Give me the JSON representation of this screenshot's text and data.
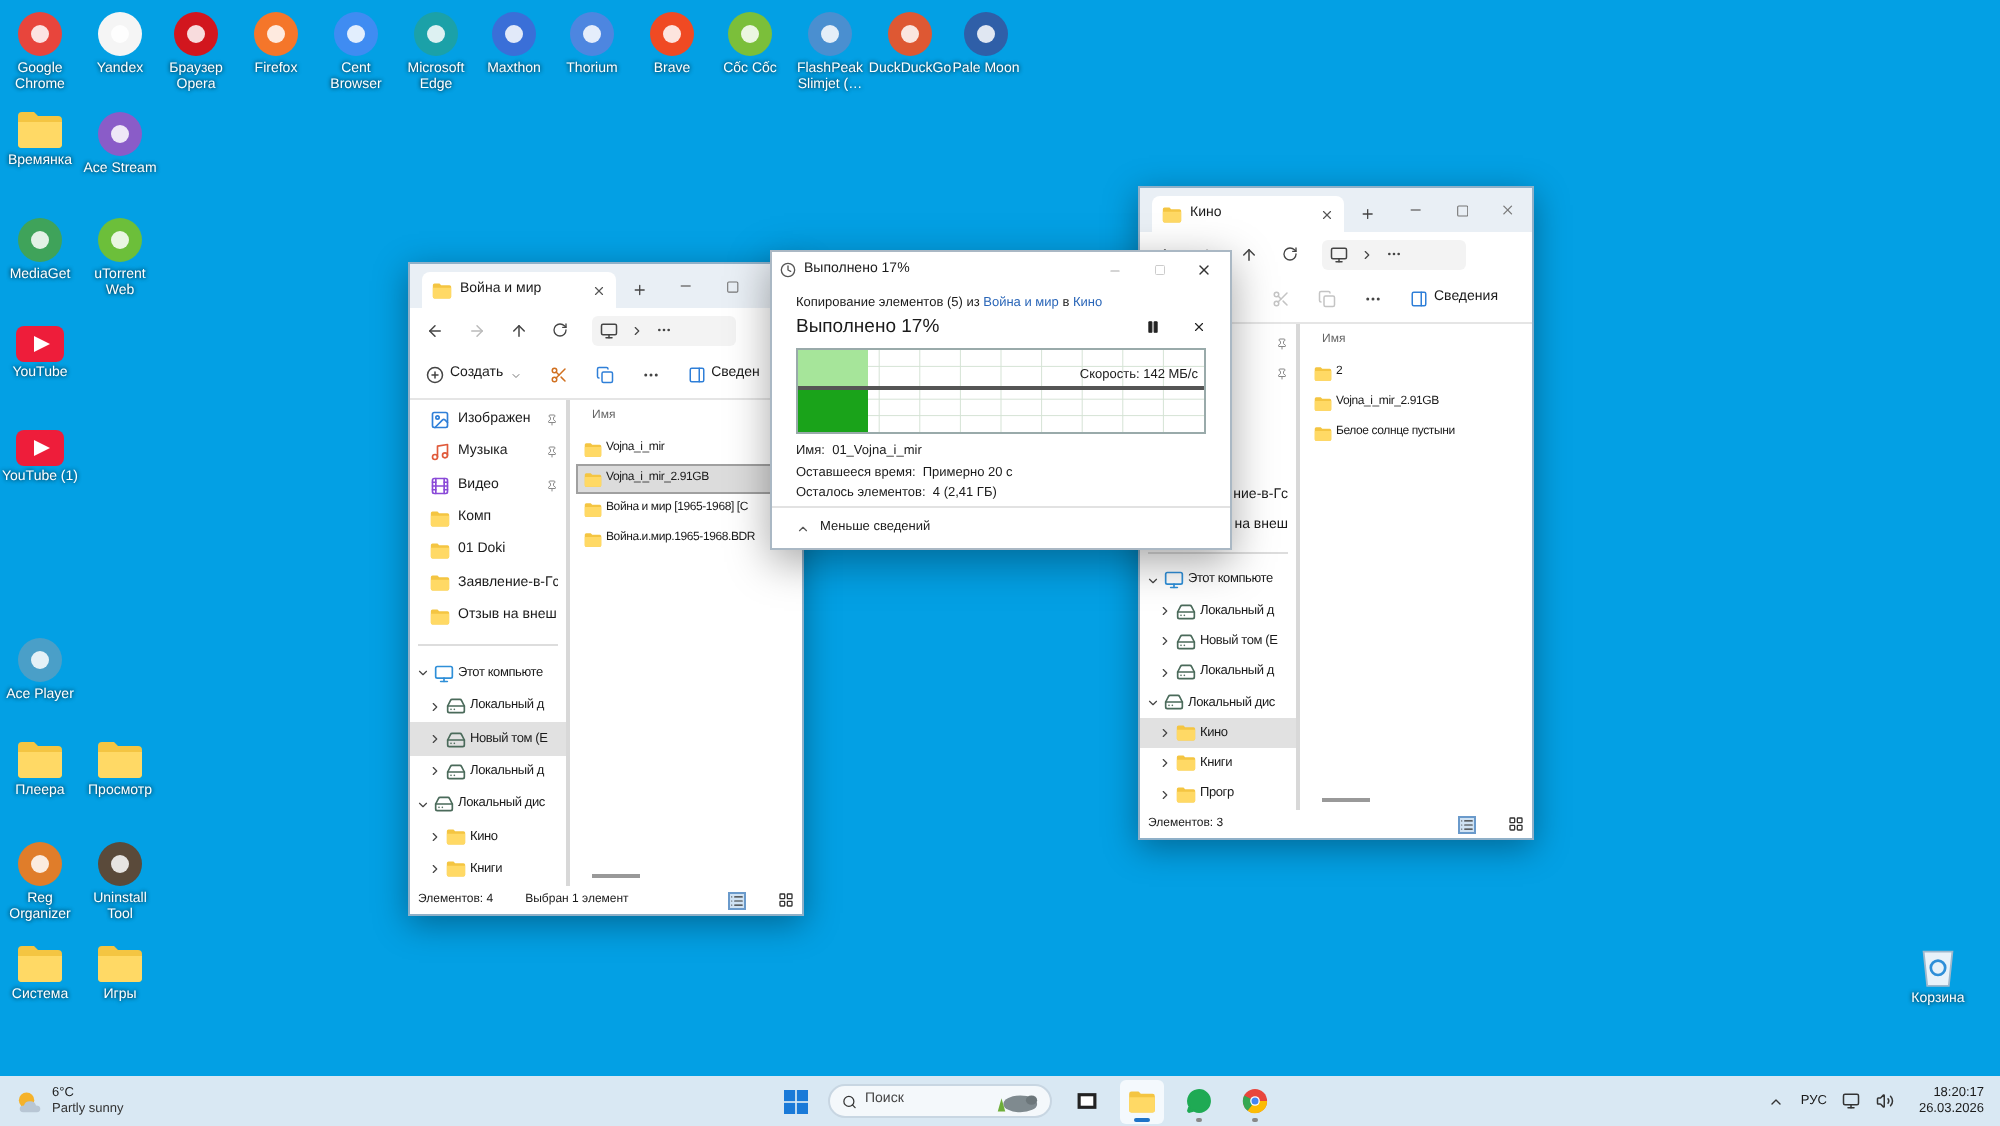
{
  "desktop": {
    "top_row": [
      {
        "label": "Google Chrome",
        "kind": "app",
        "color": "#e8453c"
      },
      {
        "label": "Yandex",
        "kind": "app",
        "color": "#f5f5f5"
      },
      {
        "label": "Браузер Opera",
        "kind": "app",
        "color": "#d2161e"
      },
      {
        "label": "Firefox",
        "kind": "app",
        "color": "#f5762a"
      },
      {
        "label": "Cent Browser",
        "kind": "app",
        "color": "#3f8cf2"
      },
      {
        "label": "Microsoft Edge",
        "kind": "app",
        "color": "#1ba1a8"
      },
      {
        "label": "Maxthon",
        "kind": "app",
        "color": "#3a6fd8"
      },
      {
        "label": "Thorium",
        "kind": "app",
        "color": "#4d86e0"
      },
      {
        "label": "Brave",
        "kind": "app",
        "color": "#f04a23"
      },
      {
        "label": "Cốc Cốc",
        "kind": "app",
        "color": "#7bbf3a"
      },
      {
        "label": "FlashPeak Slimjet (…",
        "kind": "app",
        "color": "#4a8fd0"
      },
      {
        "label": "DuckDuckGo",
        "kind": "app",
        "color": "#de5833"
      },
      {
        "label": "Pale Moon",
        "kind": "app",
        "color": "#2f5fa8"
      }
    ],
    "left_icons": [
      {
        "label": "Времянка",
        "kind": "folder"
      },
      {
        "label": "Ace Stream",
        "kind": "app",
        "color": "#8a5cc8"
      },
      {
        "label": "MediaGet",
        "kind": "app",
        "color": "#3fa35a"
      },
      {
        "label": "uTorrent Web",
        "kind": "app",
        "color": "#6cbf3a"
      },
      {
        "label": "YouTube",
        "kind": "video"
      },
      {
        "label": "YouTube (1)",
        "kind": "video"
      },
      {
        "label": "Ace Player",
        "kind": "app",
        "color": "#4a9fc8"
      },
      {
        "label": "Плеера",
        "kind": "folder"
      },
      {
        "label": "Просмотр",
        "kind": "folder"
      },
      {
        "label": "Reg Organizer",
        "kind": "app",
        "color": "#e07d2a"
      },
      {
        "label": "Uninstall Tool",
        "kind": "app",
        "color": "#5a4a3a"
      },
      {
        "label": "Система",
        "kind": "folder"
      },
      {
        "label": "Игры",
        "kind": "folder"
      }
    ],
    "right_icons": [
      {
        "label": "Корзина",
        "kind": "bin"
      }
    ]
  },
  "explorer_left": {
    "tab": "Война и мир",
    "toolbar": {
      "create": "Создать",
      "edit_disabled": false,
      "details": "Сведен"
    },
    "quick_access": [
      {
        "label": "Изображен",
        "kind": "pictures",
        "pinned": true
      },
      {
        "label": "Музыка",
        "kind": "music",
        "pinned": true
      },
      {
        "label": "Видео",
        "kind": "videos",
        "pinned": true
      },
      {
        "label": "Комп",
        "kind": "folder",
        "pinned": false
      },
      {
        "label": "01 Doki",
        "kind": "folder",
        "pinned": false
      },
      {
        "label": "Заявление-в-Гс",
        "kind": "folder",
        "pinned": false
      },
      {
        "label": "Отзыв на внеш",
        "kind": "folder",
        "pinned": false
      }
    ],
    "tree": [
      {
        "label": "Этот компьюте",
        "kind": "pc",
        "expanded": true,
        "selected": false,
        "children": [
          {
            "label": "Локальный д",
            "kind": "drive",
            "expanded": false,
            "selected": false
          },
          {
            "label": "Новый том (E",
            "kind": "drive",
            "expanded": false,
            "selected": true
          },
          {
            "label": "Локальный д",
            "kind": "drive",
            "expanded": false,
            "selected": false
          }
        ]
      },
      {
        "label": "Локальный дис",
        "kind": "drive",
        "expanded": true,
        "selected": false,
        "children": [
          {
            "label": "Кино",
            "kind": "folder",
            "expanded": false,
            "selected": false
          },
          {
            "label": "Книги",
            "kind": "folder",
            "expanded": false,
            "selected": false
          }
        ]
      }
    ],
    "column": "Имя",
    "files": [
      {
        "name": "Vojna_i_mir",
        "selected": false
      },
      {
        "name": "Vojna_i_mir_2.91GB",
        "selected": true
      },
      {
        "name": "Война и мир [1965-1968] [C",
        "selected": false
      },
      {
        "name": "Война.и.мир.1965-1968.BDR",
        "selected": false
      }
    ],
    "status": [
      "Элементов: 4",
      "Выбран 1 элемент"
    ]
  },
  "explorer_right": {
    "tab": "Кино",
    "toolbar": {
      "edit_disabled": true,
      "details": "Сведения"
    },
    "quick_access": [
      {
        "pinned": true
      },
      {
        "pinned": true
      },
      {
        "pinned": false
      },
      {
        "pinned": false
      },
      {
        "pinned": false
      },
      {
        "label": "ние-в-Гс",
        "pinned": false
      },
      {
        "label": "на внеш",
        "pinned": false
      }
    ],
    "tree": [
      {
        "label": "Этот компьюте",
        "kind": "pc",
        "expanded": true,
        "selected": false,
        "children": [
          {
            "label": "Локальный д",
            "kind": "drive",
            "expanded": false,
            "selected": false
          },
          {
            "label": "Новый том (E",
            "kind": "drive",
            "expanded": false,
            "selected": false
          },
          {
            "label": "Локальный д",
            "kind": "drive",
            "expanded": false,
            "selected": false
          }
        ]
      },
      {
        "label": "Локальный дис",
        "kind": "drive",
        "expanded": true,
        "selected": false,
        "children": [
          {
            "label": "Кино",
            "kind": "folder",
            "expanded": false,
            "selected": true
          },
          {
            "label": "Книги",
            "kind": "folder",
            "expanded": false,
            "selected": false
          },
          {
            "label": "Прогр",
            "kind": "folder",
            "expanded": false,
            "selected": false
          }
        ]
      }
    ],
    "column": "Имя",
    "files": [
      {
        "name": "2",
        "selected": false
      },
      {
        "name": "Vojna_i_mir_2.91GB",
        "selected": false
      },
      {
        "name": "Белое солнце пустыни",
        "selected": false
      }
    ],
    "status": [
      "Элементов: 3"
    ]
  },
  "dialog": {
    "title": "Выполнено 17%",
    "copy_prefix": "Копирование элементов (5) из",
    "source": "Война и мир",
    "copy_middle": "в",
    "target": "Кино",
    "heading": "Выполнено 17%",
    "progress": {
      "level": 0.17,
      "speed": "Скорость: 142 МБ/с"
    },
    "details": [
      "Имя:  01_Vojna_i_mir",
      "Оставшееся время:  Примерно 20 с",
      "Осталось элементов:  4 (2,41 ГБ)"
    ],
    "details_expanded": true,
    "toggle": "Меньше сведений"
  },
  "taskbar": {
    "temperature": "6°C",
    "weather": "Partly sunny",
    "search_placeholder": "Поиск",
    "apps": [
      {
        "kind": "taskview",
        "active": false,
        "running": false
      },
      {
        "kind": "explorer",
        "active": true,
        "running": true
      },
      {
        "kind": "whatsapp",
        "active": false,
        "running": true
      },
      {
        "kind": "chrome",
        "active": false,
        "running": true
      }
    ],
    "language": "РУС",
    "time": "18:20:17",
    "date": "26.03.2026"
  }
}
